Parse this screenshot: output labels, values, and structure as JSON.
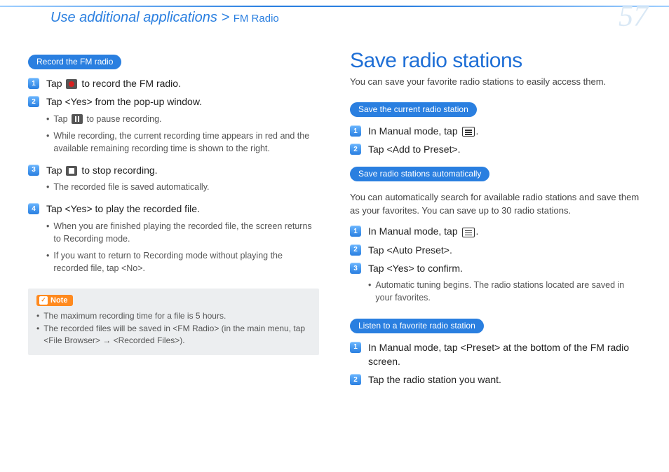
{
  "header": {
    "breadcrumb_main": "Use additional applications > ",
    "breadcrumb_sub": "FM Radio",
    "page_number": "57"
  },
  "left": {
    "pill1": "Record the FM radio",
    "steps": [
      {
        "num": "1",
        "pre": "Tap ",
        "icon": "record",
        "post": " to record the FM radio."
      },
      {
        "num": "2",
        "text": "Tap <Yes> from the pop-up window.",
        "subs": [
          {
            "pre": "Tap ",
            "icon": "pause",
            "post": " to pause recording."
          },
          {
            "text": "While recording, the current recording time appears in red and the available remaining recording time is shown to the right."
          }
        ]
      },
      {
        "num": "3",
        "pre": "Tap ",
        "icon": "stop",
        "post": " to stop recording.",
        "subs": [
          {
            "text": "The recorded file is saved automatically."
          }
        ]
      },
      {
        "num": "4",
        "text": "Tap <Yes> to play the recorded file.",
        "subs": [
          {
            "text": "When you are finished playing the recorded file, the screen returns to Recording mode."
          },
          {
            "text": "If you want to return to Recording mode without playing the recorded file, tap <No>."
          }
        ]
      }
    ],
    "note": {
      "label": "Note",
      "items": [
        "The maximum recording time for a file is 5 hours.",
        "The recorded files will be saved in <FM Radio> (in the main menu, tap <File Browser> → <Recorded Files>)."
      ]
    }
  },
  "right": {
    "title": "Save radio stations",
    "subtitle": "You can save your favorite radio stations to easily access them.",
    "pill_current": "Save the current radio station",
    "current_steps": [
      {
        "num": "1",
        "pre": "In Manual mode, tap ",
        "icon": "menu",
        "post": "."
      },
      {
        "num": "2",
        "text": "Tap <Add to Preset>."
      }
    ],
    "pill_auto": "Save radio stations automatically",
    "auto_intro": "You can automatically search for available radio stations and save them as your favorites. You can save up to 30 radio stations.",
    "auto_steps": [
      {
        "num": "1",
        "pre": "In Manual mode, tap ",
        "icon": "menu",
        "post": "."
      },
      {
        "num": "2",
        "text": "Tap <Auto Preset>."
      },
      {
        "num": "3",
        "text": "Tap <Yes> to confirm.",
        "subs": [
          {
            "text": "Automatic tuning begins. The radio stations located are saved in your favorites."
          }
        ]
      }
    ],
    "pill_listen": "Listen to a favorite radio station",
    "listen_steps": [
      {
        "num": "1",
        "text": "In Manual mode, tap <Preset> at the bottom of the FM radio screen."
      },
      {
        "num": "2",
        "text": "Tap the radio station you want."
      }
    ]
  }
}
